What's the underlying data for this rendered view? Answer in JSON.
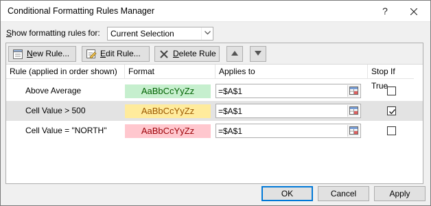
{
  "window": {
    "title": "Conditional Formatting Rules Manager",
    "help_glyph": "?"
  },
  "show_rules": {
    "label_underlined": "S",
    "label_rest": "how formatting rules for:",
    "selected": "Current Selection"
  },
  "toolbar": {
    "new_rule_u": "N",
    "new_rule_rest": "ew Rule...",
    "edit_rule_u": "E",
    "edit_rule_rest": "dit Rule...",
    "delete_rule_u": "D",
    "delete_rule_rest": "elete Rule"
  },
  "grid": {
    "headers": [
      "Rule (applied in order shown)",
      "Format",
      "Applies to",
      "Stop If True"
    ],
    "rows": [
      {
        "rule": "Above Average",
        "preview": "AaBbCcYyZz",
        "preview_bg": "#c6efce",
        "preview_fg": "#006100",
        "applies_to": "=$A$1",
        "stop_if_true": false,
        "selected": false
      },
      {
        "rule": "Cell Value > 500",
        "preview": "AaBbCcYyZz",
        "preview_bg": "#ffeb9c",
        "preview_fg": "#9c5700",
        "applies_to": "=$A$1",
        "stop_if_true": true,
        "selected": true
      },
      {
        "rule": "Cell Value = \"NORTH\"",
        "preview": "AaBbCcYyZz",
        "preview_bg": "#ffc7ce",
        "preview_fg": "#9c0006",
        "applies_to": "=$A$1",
        "stop_if_true": false,
        "selected": false
      }
    ]
  },
  "buttons": {
    "ok": "OK",
    "cancel": "Cancel",
    "apply": "Apply"
  },
  "colors": {
    "accent": "#0078d7",
    "selected_row": "#e3e3e3"
  }
}
